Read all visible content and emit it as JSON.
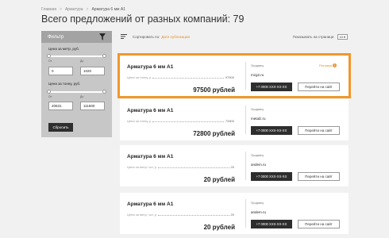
{
  "breadcrumb": [
    "Главная",
    "Арматура",
    "Арматура 6 мм А1"
  ],
  "page_title": "Всего предложений от разных компаний: 79",
  "filter": {
    "title": "Фильтр",
    "price_per_meter_label": "Цена за метр, руб.",
    "price_per_ton_label": "Цена за тонну, руб.",
    "from_label": "От",
    "to_label": "До",
    "meter_from": "0",
    "meter_to": "1020",
    "ton_from": "20631",
    "ton_to": "111600",
    "reset_label": "Сбросить"
  },
  "sort": {
    "label": "Сортировать по:",
    "value": "Дате публикации",
    "per_page_label": "Показывать на странице:",
    "per_page_value": "10"
  },
  "offers": [
    {
      "title": "Арматура 6 мм А1",
      "price_label": "Цена за тонну, р",
      "price_value": "97500",
      "big_price": "97500 рублей",
      "seller_label": "Продавец",
      "seller": "mzg2.ru",
      "promo": "Реклама",
      "phone": "+7 0000 XXX-XX-XX",
      "site_label": "Перейти на сайт"
    },
    {
      "title": "Арматура 6 мм А1",
      "price_label": "Цена за тонну, р",
      "price_value": "72800",
      "big_price": "72800 рублей",
      "seller_label": "Продавец",
      "seller": "metalz.ru",
      "phone": "+7 0000 XXX-XX-XX",
      "site_label": "Перейти на сайт"
    },
    {
      "title": "Арматура 6 мм А1",
      "price_label": "Цена за метр / шт, р",
      "price_value": "20",
      "big_price": "20 рублей",
      "seller_label": "Продавец",
      "seller": "andem.ru",
      "phone": "+7 0000 XXX-XX-XX",
      "site_label": "Перейти на сайт"
    },
    {
      "title": "Арматура 6 мм А1",
      "price_label": "Цена за метр / шт, р",
      "price_value": "20",
      "big_price": "20 рублей",
      "seller_label": "Продавец",
      "seller": "andem.ru",
      "phone": "+7 0000 XXX-XX-XX",
      "site_label": "Перейти на сайт"
    }
  ],
  "colors": {
    "accent": "#f0972c",
    "dark_button": "#2e2e2e",
    "filter_panel": "#c7c7c7",
    "filter_header": "#a3a3a3",
    "page_bg": "#f1f1f1"
  }
}
